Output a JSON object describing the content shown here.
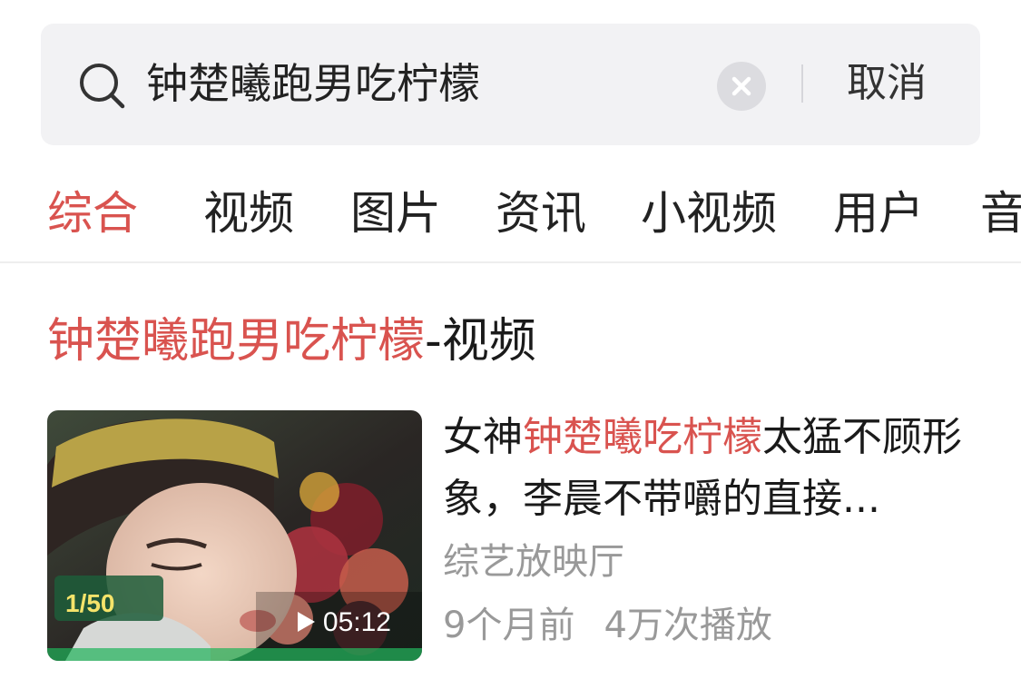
{
  "search": {
    "query": "钟楚曦跑男吃柠檬",
    "cancel_label": "取消"
  },
  "tabs": [
    {
      "label": "综合",
      "active": true
    },
    {
      "label": "视频",
      "active": false
    },
    {
      "label": "图片",
      "active": false
    },
    {
      "label": "资讯",
      "active": false
    },
    {
      "label": "小视频",
      "active": false
    },
    {
      "label": "用户",
      "active": false
    },
    {
      "label": "音",
      "active": false
    }
  ],
  "section": {
    "title_highlight": "钟楚曦跑男吃柠檬",
    "title_suffix": "-视频"
  },
  "results": [
    {
      "title_prefix": "女神",
      "title_highlight": "钟楚曦吃柠檬",
      "title_suffix": "太猛不顾形象，李晨不带嚼的直接...",
      "source": "综艺放映厅",
      "age": "9个月前",
      "plays": "4万次播放",
      "duration": "05:12",
      "thumbnail_overlay_text": "1/50"
    }
  ],
  "colors": {
    "accent": "#d9534f",
    "search_bg": "#f2f2f4",
    "meta_text": "#999999"
  }
}
